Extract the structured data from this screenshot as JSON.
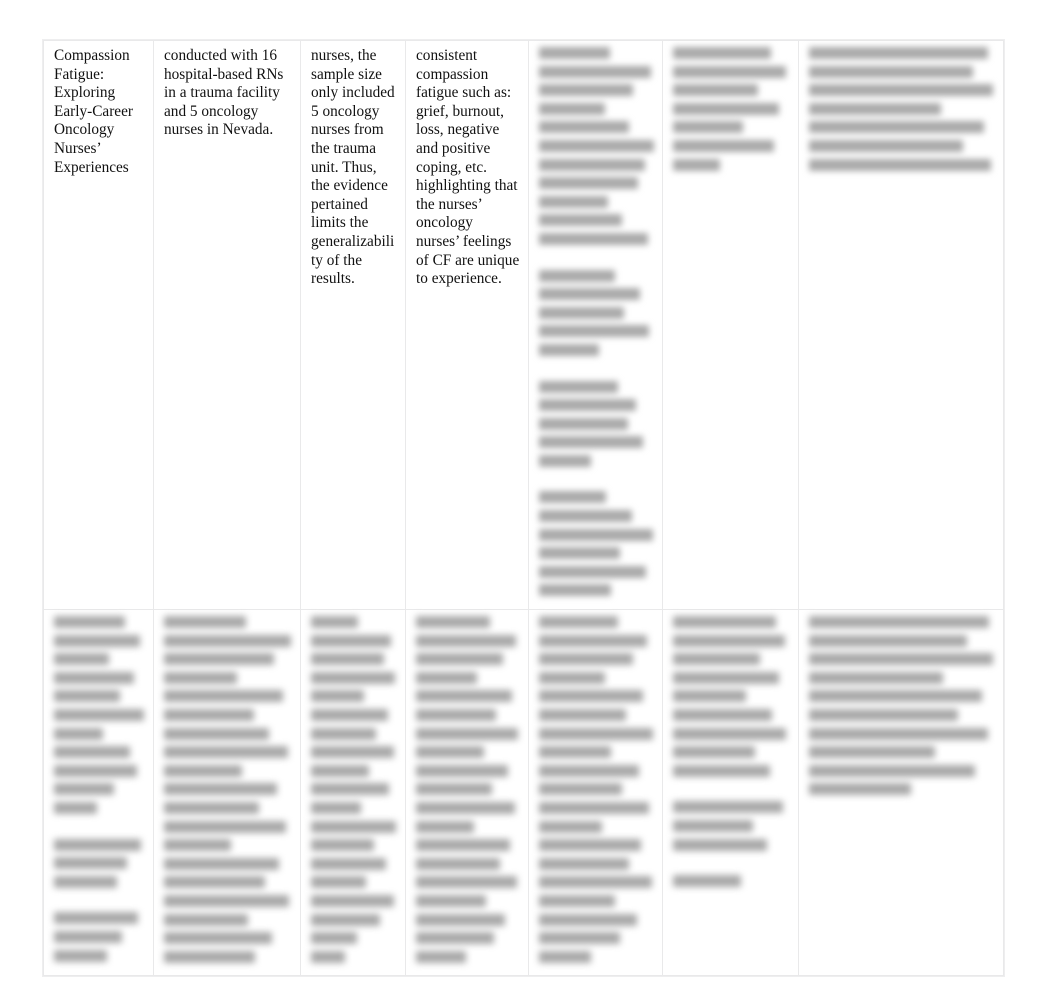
{
  "document": {
    "type": "table",
    "description": "Literature evaluation matrix table, 7 columns by 2 rows. Left four cells of the first row are legible; the remaining cells are blurred/redacted.",
    "background_color": "#ffffff",
    "text_color": "#111111",
    "border_color": "#e9e9ea",
    "redaction_color": "#a9a9a9"
  },
  "table": {
    "column_count": 7,
    "row_count": 2,
    "rows": [
      {
        "id": "row-1",
        "cells": [
          {
            "id": "r1c1",
            "column": 1,
            "redacted": false,
            "text": "Compassion Fatigue: Exploring Early-Career Oncology Nurses’ Experiences"
          },
          {
            "id": "r1c2",
            "column": 2,
            "redacted": false,
            "text": "conducted with 16 hospital-based RNs in a trauma facility and 5 oncology nurses in Nevada."
          },
          {
            "id": "r1c3",
            "column": 3,
            "redacted": false,
            "text": "nurses, the sample size only included 5 oncology nurses from the trauma unit. Thus, the evidence pertained limits the generalizability of the results."
          },
          {
            "id": "r1c4",
            "column": 4,
            "redacted": false,
            "text": "consistent compassion fatigue such as: grief, burnout, loss, negative and positive coping, etc. highlighting that the nurses’ oncology nurses’ feelings of CF are unique to experience."
          },
          {
            "id": "r1c5",
            "column": 5,
            "redacted": true,
            "text": "",
            "redacted_line_widths": [
              62,
              97,
              82,
              57,
              78,
              100,
              92,
              86,
              60,
              72,
              95,
              0,
              66,
              88,
              74,
              96,
              52,
              0,
              69,
              84,
              77,
              90,
              45,
              0,
              58,
              81,
              99,
              70,
              93,
              63
            ]
          },
          {
            "id": "r1c6",
            "column": 6,
            "redacted": true,
            "text": "",
            "redacted_line_widths": [
              84,
              97,
              73,
              91,
              60,
              86,
              40
            ]
          },
          {
            "id": "r1c7",
            "column": 7,
            "redacted": true,
            "text": "",
            "redacted_line_widths": [
              96,
              88,
              99,
              71,
              94,
              83,
              98
            ]
          }
        ]
      },
      {
        "id": "row-2",
        "cells": [
          {
            "id": "r2c1",
            "column": 1,
            "redacted": true,
            "text": "",
            "redacted_line_widths": [
              78,
              95,
              60,
              88,
              72,
              99,
              54,
              83,
              91,
              66,
              47,
              0,
              96,
              80,
              69,
              0,
              92,
              75,
              58
            ]
          },
          {
            "id": "r2c2",
            "column": 2,
            "redacted": true,
            "text": "",
            "redacted_line_widths": [
              64,
              99,
              86,
              57,
              93,
              70,
              82,
              97,
              61,
              88,
              74,
              95,
              52,
              90,
              79,
              98,
              66,
              84,
              71
            ]
          },
          {
            "id": "r2c3",
            "column": 3,
            "redacted": true,
            "text": "",
            "redacted_line_widths": [
              55,
              93,
              85,
              98,
              62,
              89,
              76,
              97,
              68,
              91,
              58,
              99,
              73,
              87,
              64,
              96,
              80,
              53,
              40
            ]
          },
          {
            "id": "r2c4",
            "column": 4,
            "redacted": true,
            "text": "",
            "redacted_line_widths": [
              71,
              96,
              84,
              59,
              92,
              77,
              98,
              65,
              88,
              73,
              95,
              56,
              90,
              81,
              97,
              67,
              86,
              75,
              48
            ]
          },
          {
            "id": "r2c5",
            "column": 5,
            "redacted": true,
            "text": "",
            "redacted_line_widths": [
              69,
              94,
              82,
              57,
              90,
              76,
              99,
              63,
              87,
              72,
              96,
              55,
              89,
              78,
              98,
              66,
              85,
              70,
              45
            ]
          },
          {
            "id": "r2c6",
            "column": 6,
            "redacted": true,
            "text": "",
            "redacted_line_widths": [
              88,
              96,
              74,
              91,
              62,
              85,
              97,
              70,
              83,
              0,
              94,
              68,
              80,
              0,
              58
            ]
          },
          {
            "id": "r2c7",
            "column": 7,
            "redacted": true,
            "text": "",
            "redacted_line_widths": [
              97,
              85,
              99,
              72,
              93,
              80,
              96,
              68,
              89,
              55
            ]
          }
        ]
      }
    ]
  }
}
